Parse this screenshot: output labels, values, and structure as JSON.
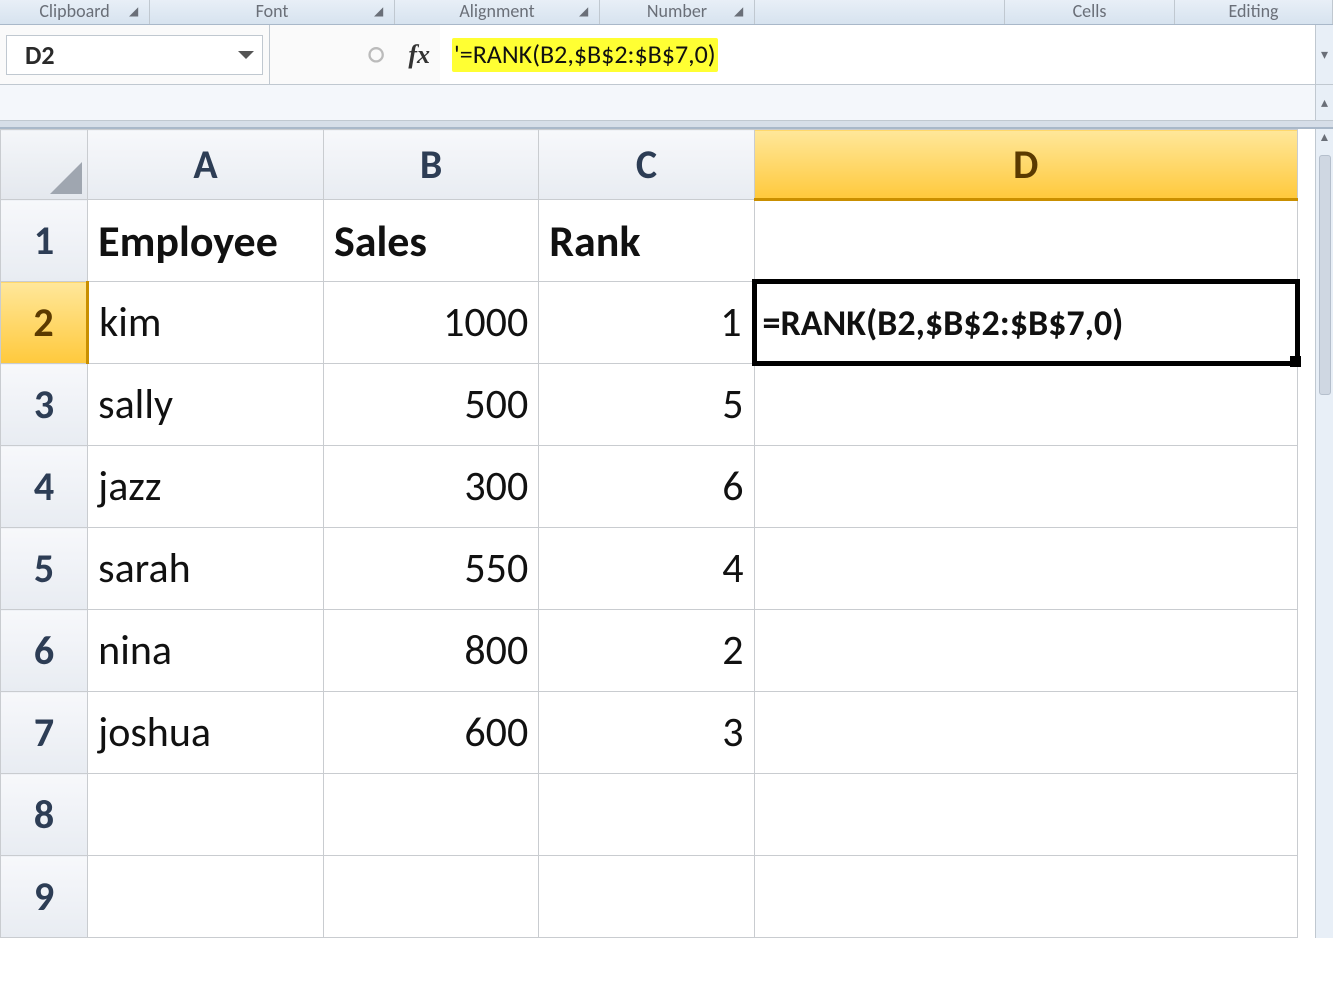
{
  "ribbon_groups": {
    "clipboard": "Clipboard",
    "font": "Font",
    "alignment": "Alignment",
    "number": "Number",
    "cells": "Cells",
    "editing": "Editing",
    "blank": ""
  },
  "namebox": {
    "value": "D2"
  },
  "fx_symbol": "fx",
  "formula_bar_text": "'=RANK(B2,$B$2:$B$7,0)",
  "columns": [
    "A",
    "B",
    "C",
    "D"
  ],
  "row_headers": [
    "1",
    "2",
    "3",
    "4",
    "5",
    "6",
    "7",
    "8",
    "9"
  ],
  "headers": {
    "A": "Employee",
    "B": "Sales",
    "C": "Rank",
    "D": ""
  },
  "rows": [
    {
      "employee": "kim",
      "sales": "1000",
      "rank": "1"
    },
    {
      "employee": "sally",
      "sales": "500",
      "rank": "5"
    },
    {
      "employee": "jazz",
      "sales": "300",
      "rank": "6"
    },
    {
      "employee": "sarah",
      "sales": "550",
      "rank": "4"
    },
    {
      "employee": "nina",
      "sales": "800",
      "rank": "2"
    },
    {
      "employee": "joshua",
      "sales": "600",
      "rank": "3"
    }
  ],
  "active_cell_display": "=RANK(B2,$B$2:$B$7,0)",
  "active_col": "D",
  "active_row": "2"
}
